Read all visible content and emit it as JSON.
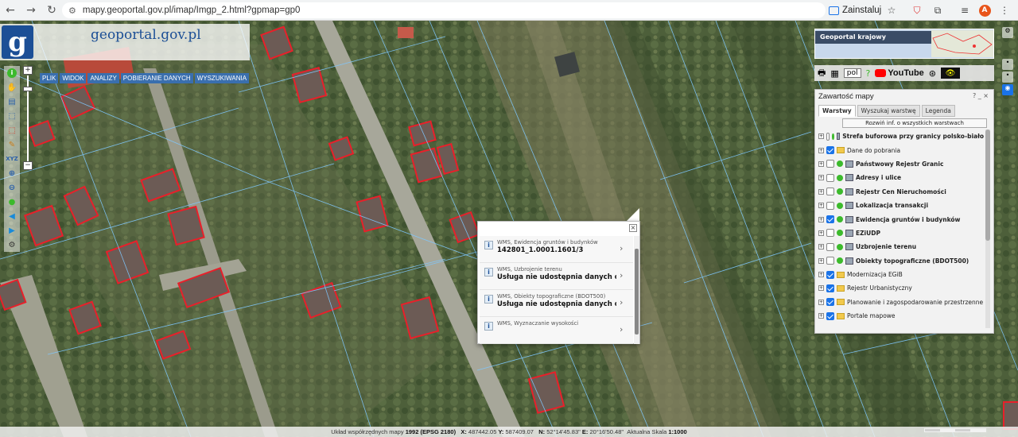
{
  "browser": {
    "url": "mapy.geoportal.gov.pl/imap/Imgp_2.html?gpmap=gp0",
    "install_label": "Zainstaluj",
    "avatar_letter": "A"
  },
  "header": {
    "logo_letter": "g",
    "logo_text": "geoportal.gov.pl",
    "menu": [
      "PLIK",
      "WIDOK",
      "ANALIZY",
      "POBIERANIE DANYCH",
      "WYSZUKIWANIA"
    ]
  },
  "overview": {
    "title": "Geoportal krajowy"
  },
  "tool_row": {
    "language": "pol",
    "youtube_label": "YouTube"
  },
  "panel": {
    "title": "Zawartość mapy",
    "controls": "? _ ×",
    "tabs": [
      "Warstwy",
      "Wyszukaj warstwę",
      "Legenda"
    ],
    "expand_button": "Rozwiń inf. o wszystkich warstwach",
    "layers": [
      {
        "label": "Strefa buforowa przy granicy polsko-biało",
        "checked": false,
        "bold": true,
        "kind": "service"
      },
      {
        "label": "Dane do pobrania",
        "checked": true,
        "bold": false,
        "kind": "folder"
      },
      {
        "label": "Państwowy Rejestr Granic",
        "checked": false,
        "bold": true,
        "kind": "service"
      },
      {
        "label": "Adresy i ulice",
        "checked": false,
        "bold": true,
        "kind": "service"
      },
      {
        "label": "Rejestr Cen Nieruchomości",
        "checked": false,
        "bold": true,
        "kind": "service"
      },
      {
        "label": "Lokalizacja transakcji",
        "checked": false,
        "bold": true,
        "kind": "service"
      },
      {
        "label": "Ewidencja gruntów i budynków",
        "checked": true,
        "bold": true,
        "kind": "service"
      },
      {
        "label": "EZiUDP",
        "checked": false,
        "bold": true,
        "kind": "service"
      },
      {
        "label": "Uzbrojenie terenu",
        "checked": false,
        "bold": true,
        "kind": "service"
      },
      {
        "label": "Obiekty topograficzne (BDOT500)",
        "checked": false,
        "bold": true,
        "kind": "service"
      },
      {
        "label": "Modernizacja EGiB",
        "checked": true,
        "bold": false,
        "kind": "folder"
      },
      {
        "label": "Rejestr Urbanistyczny",
        "checked": true,
        "bold": false,
        "kind": "folder"
      },
      {
        "label": "Planowanie i zagospodarowanie przestrzenne",
        "checked": true,
        "bold": false,
        "kind": "folder"
      },
      {
        "label": "Portale mapowe",
        "checked": true,
        "bold": false,
        "kind": "folder"
      }
    ]
  },
  "popup": {
    "items": [
      {
        "service": "WMS, Ewidencja gruntów i budynków",
        "value": "142801_1.0001.1601/3"
      },
      {
        "service": "WMS, Uzbrojenie terenu",
        "value": "Usługa nie udostępnia danych opi..."
      },
      {
        "service": "WMS, Obiekty topograficzne (BDOT500)",
        "value": "Usługa nie udostępnia danych opi..."
      },
      {
        "service": "WMS, Wyznaczanie wysokości",
        "value": ""
      }
    ]
  },
  "status": {
    "crs_label": "Układ współrzędnych mapy",
    "crs_value": "1992 (EPSG 2180)",
    "x_label": "X:",
    "x_value": "487442.05",
    "y_label": "Y:",
    "y_value": "587409.07",
    "n_label": "N:",
    "n_value": "52°14'45.83\"",
    "e_label": "E:",
    "e_value": "20°16'50.48\"",
    "scale_label": "Aktualna Skala",
    "scale_value": "1:1000"
  },
  "colors": {
    "parcel_border": "#e8202a",
    "parcel_lines": "#7fc8ff",
    "brand_blue": "#1c4f96"
  }
}
